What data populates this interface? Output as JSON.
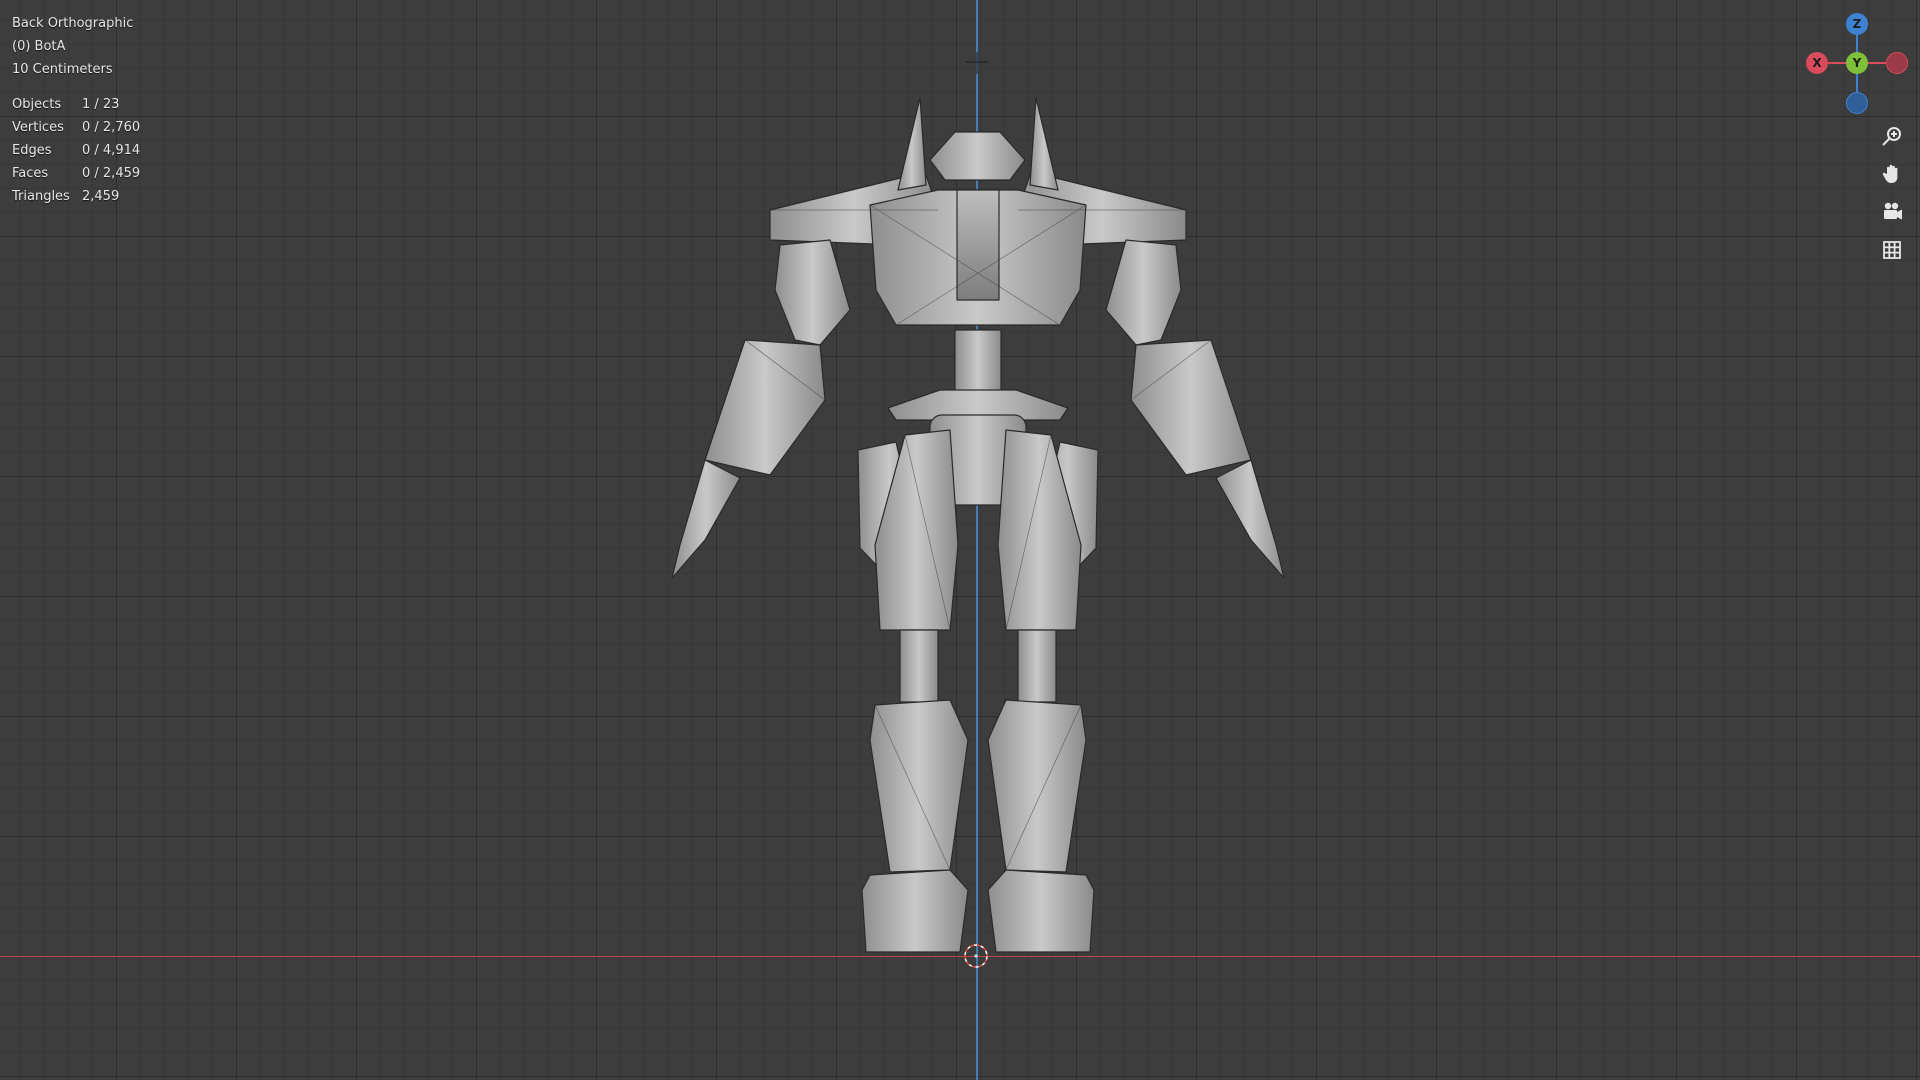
{
  "viewport": {
    "view_name": "Back Orthographic",
    "collection_object": "(0) BotA",
    "grid_scale": "10 Centimeters",
    "stats": [
      {
        "label": "Objects",
        "value": "1 / 23"
      },
      {
        "label": "Vertices",
        "value": "0 / 2,760"
      },
      {
        "label": "Edges",
        "value": "0 / 4,914"
      },
      {
        "label": "Faces",
        "value": "0 / 2,459"
      },
      {
        "label": "Triangles",
        "value": "2,459"
      }
    ]
  },
  "gizmo": {
    "z_label": "Z",
    "y_label": "Y",
    "x_label": "X",
    "colors": {
      "x": "#d94b5b",
      "y": "#7fc03a",
      "z": "#3d82d2"
    }
  },
  "nav_tools": [
    {
      "icon": "zoom-icon"
    },
    {
      "icon": "hand-pan-icon"
    },
    {
      "icon": "camera-icon"
    },
    {
      "icon": "grid-ortho-icon"
    }
  ]
}
